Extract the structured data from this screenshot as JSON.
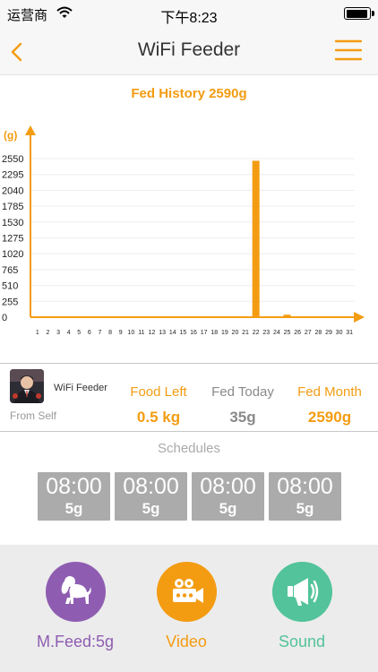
{
  "status_bar": {
    "carrier": "运营商",
    "time": "下午8:23"
  },
  "nav": {
    "title": "WiFi Feeder"
  },
  "chart_data": {
    "type": "bar",
    "title": "Fed History 2590g",
    "ylabel": "(g)",
    "xlabel": "",
    "categories": [
      "1",
      "2",
      "3",
      "4",
      "5",
      "6",
      "7",
      "8",
      "9",
      "10",
      "11",
      "12",
      "13",
      "14",
      "15",
      "16",
      "17",
      "18",
      "19",
      "20",
      "21",
      "22",
      "23",
      "24",
      "25",
      "26",
      "27",
      "28",
      "29",
      "30",
      "31"
    ],
    "values": [
      0,
      0,
      0,
      0,
      0,
      0,
      0,
      0,
      0,
      0,
      0,
      0,
      0,
      0,
      0,
      0,
      0,
      0,
      0,
      0,
      0,
      2515,
      10,
      0,
      40,
      0,
      0,
      0,
      0,
      0,
      0
    ],
    "y_ticks": [
      "2550",
      "2295",
      "2040",
      "1785",
      "1530",
      "1275",
      "1020",
      "765",
      "510",
      "255",
      "0"
    ],
    "ylim": [
      0,
      2550
    ],
    "grid": true,
    "color": "#f39c12"
  },
  "device": {
    "name": "WiFi Feeder",
    "from": "From Self"
  },
  "stats": {
    "food_left": {
      "label": "Food Left",
      "value": "0.5 kg"
    },
    "fed_today": {
      "label": "Fed Today",
      "value": "35g"
    },
    "fed_month": {
      "label": "Fed Month",
      "value": "2590g"
    }
  },
  "schedules": {
    "title": "Schedules",
    "items": [
      {
        "time": "08:00",
        "amount": "5g"
      },
      {
        "time": "08:00",
        "amount": "5g"
      },
      {
        "time": "08:00",
        "amount": "5g"
      },
      {
        "time": "08:00",
        "amount": "5g"
      }
    ]
  },
  "actions": {
    "feed": {
      "label": "M.Feed:5g",
      "color": "#8e5db2",
      "icon": "dog-icon"
    },
    "video": {
      "label": "Video",
      "color": "#f39c12",
      "icon": "video-camera-icon"
    },
    "sound": {
      "label": "Sound",
      "color": "#52c39a",
      "icon": "megaphone-icon"
    }
  },
  "colors": {
    "accent": "#f39c12",
    "stat_gray": "#8a8a8a",
    "schedule_card": "#ababab"
  }
}
